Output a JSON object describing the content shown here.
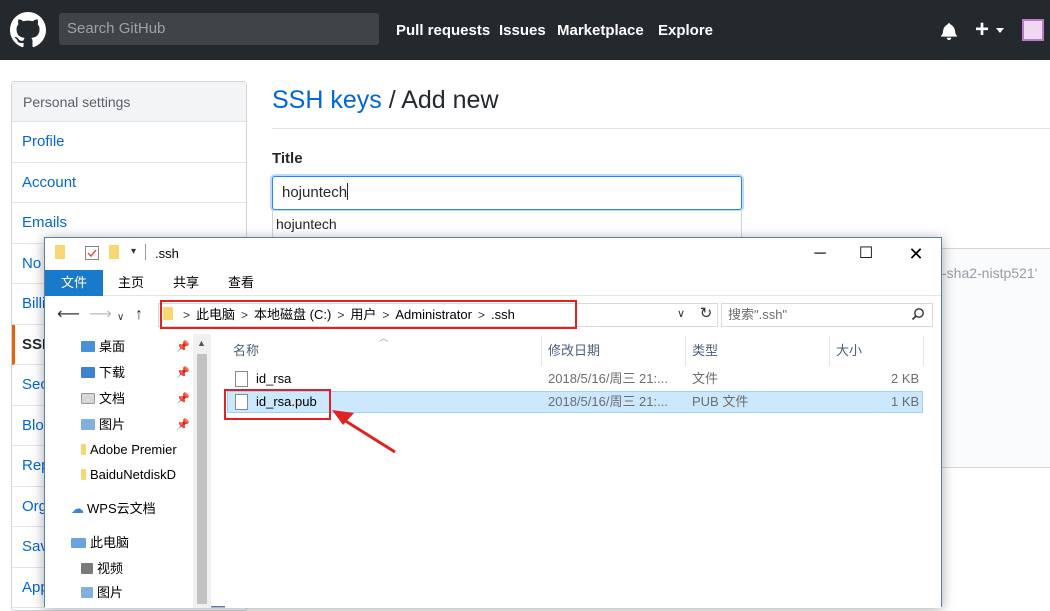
{
  "github": {
    "search_placeholder": "Search GitHub",
    "nav": [
      "Pull requests",
      "Issues",
      "Marketplace",
      "Explore"
    ],
    "icons": [
      "github-logo-icon",
      "bell-icon",
      "plus-icon",
      "avatar"
    ]
  },
  "settings_menu": {
    "heading": "Personal settings",
    "items": [
      "Profile",
      "Account",
      "Emails",
      "No",
      "Billi",
      "SSH",
      "Sec",
      "Blo",
      "Rep",
      "Org",
      "Sav",
      "App"
    ],
    "active_index": 5
  },
  "page": {
    "title_link": "SSH keys",
    "title_rest": " / Add new",
    "title_label": "Title",
    "title_value": "hojuntech",
    "autocomplete": "hojuntech",
    "key_hint": "-sha2-nistp521'"
  },
  "explorer": {
    "window_title": ".ssh",
    "ribbon_tabs": [
      "文件",
      "主页",
      "共享",
      "查看"
    ],
    "help_label": "?",
    "breadcrumbs": [
      "此电脑",
      "本地磁盘 (C:)",
      "用户",
      "Administrator",
      ".ssh"
    ],
    "search_placeholder": "搜索\".ssh\"",
    "nav_items": [
      {
        "label": "桌面",
        "pinned": true
      },
      {
        "label": "下载",
        "pinned": true
      },
      {
        "label": "文档",
        "pinned": true
      },
      {
        "label": "图片",
        "pinned": true
      },
      {
        "label": "Adobe Premier",
        "pinned": false
      },
      {
        "label": "BaiduNetdiskD",
        "pinned": false
      }
    ],
    "wps": "WPS云文档",
    "this_pc": "此电脑",
    "pc_items": [
      "视频",
      "图片"
    ],
    "columns": [
      "名称",
      "修改日期",
      "类型",
      "大小"
    ],
    "files": [
      {
        "name": "id_rsa",
        "modified": "2018/5/16/周三 21:...",
        "type": "文件",
        "size": "2 KB",
        "selected": false
      },
      {
        "name": "id_rsa.pub",
        "modified": "2018/5/16/周三 21:...",
        "type": "PUB 文件",
        "size": "1 KB",
        "selected": true
      }
    ]
  },
  "colors": {
    "gh_header": "#24292e",
    "link": "#0366d6",
    "highlight": "#e02222",
    "selection": "#cce8ff",
    "ribbon_file": "#1979ca"
  }
}
